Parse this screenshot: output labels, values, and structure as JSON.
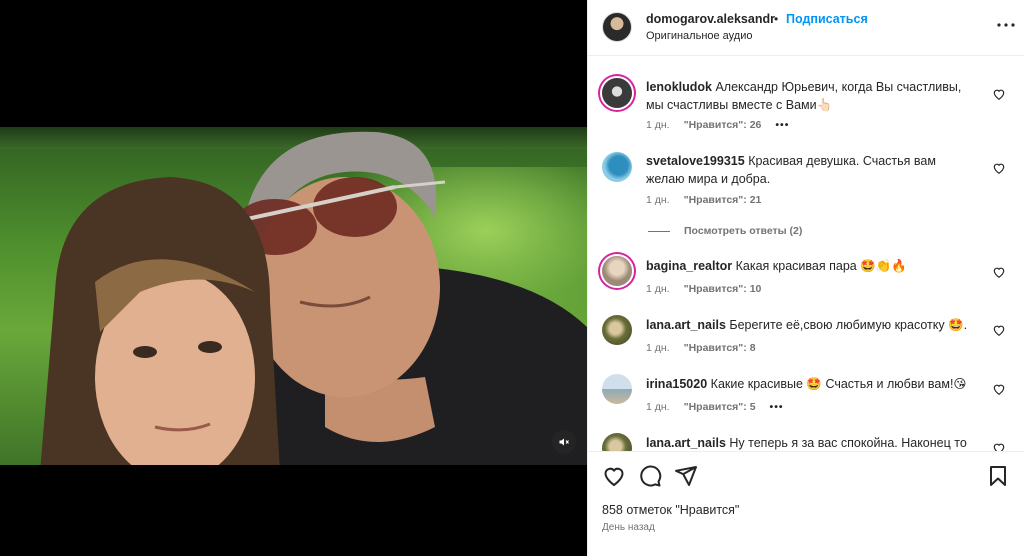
{
  "header": {
    "username": "domogarov.aleksandr",
    "separator": "•",
    "follow_label": "Подписаться",
    "audio_label": "Оригинальное аудио",
    "more_icon": "more-horizontal-icon"
  },
  "comments": [
    {
      "username": "lenokludok",
      "text": "Александр Юрьевич, когда Вы счастливы, мы счастливы вместе с Вами👆🏻",
      "time": "1 дн.",
      "likes": "\"Нравится\": 26",
      "more": "•••",
      "avatar_color": "#3a3a3a",
      "has_story_ring": true
    },
    {
      "username": "svetalove199315",
      "text": "Красивая девушка. Счастья вам желаю мира и добра.",
      "time": "1 дн.",
      "likes": "\"Нравится\": 21",
      "avatar_color": "#5aa5c9",
      "has_story_ring": false,
      "view_replies": "Посмотреть ответы (2)"
    },
    {
      "username": "bagina_realtor",
      "text": "Какая красивая пара 🤩👏🔥",
      "time": "1 дн.",
      "likes": "\"Нравится\": 10",
      "avatar_color": "#c9b8a6",
      "has_story_ring": true
    },
    {
      "username": "lana.art_nails",
      "text": "Берегите её,свою любимую красотку 🤩.",
      "time": "1 дн.",
      "likes": "\"Нравится\": 8",
      "avatar_color": "#6b6f3a",
      "has_story_ring": false
    },
    {
      "username": "irina15020",
      "text": "Какие красивые 🤩 Счастья и любви вам!😘",
      "time": "1 дн.",
      "likes": "\"Нравится\": 5",
      "more": "•••",
      "avatar_color": "#a9c4d6",
      "has_story_ring": false
    },
    {
      "username": "lana.art_nails",
      "text": "Ну теперь я за вас спокойна. Наконец то",
      "avatar_color": "#6b6f3a",
      "has_story_ring": false
    }
  ],
  "actions": {
    "like_icon": "heart-icon",
    "comment_icon": "comment-icon",
    "share_icon": "share-icon",
    "save_icon": "bookmark-icon",
    "likes_count": "858 отметок \"Нравится\"",
    "post_time": "День назад"
  },
  "media": {
    "mute_icon": "speaker-muted-icon"
  },
  "colors": {
    "link_blue": "#0095f6",
    "secondary_text": "#737373",
    "story_ring": "#d6249f"
  }
}
